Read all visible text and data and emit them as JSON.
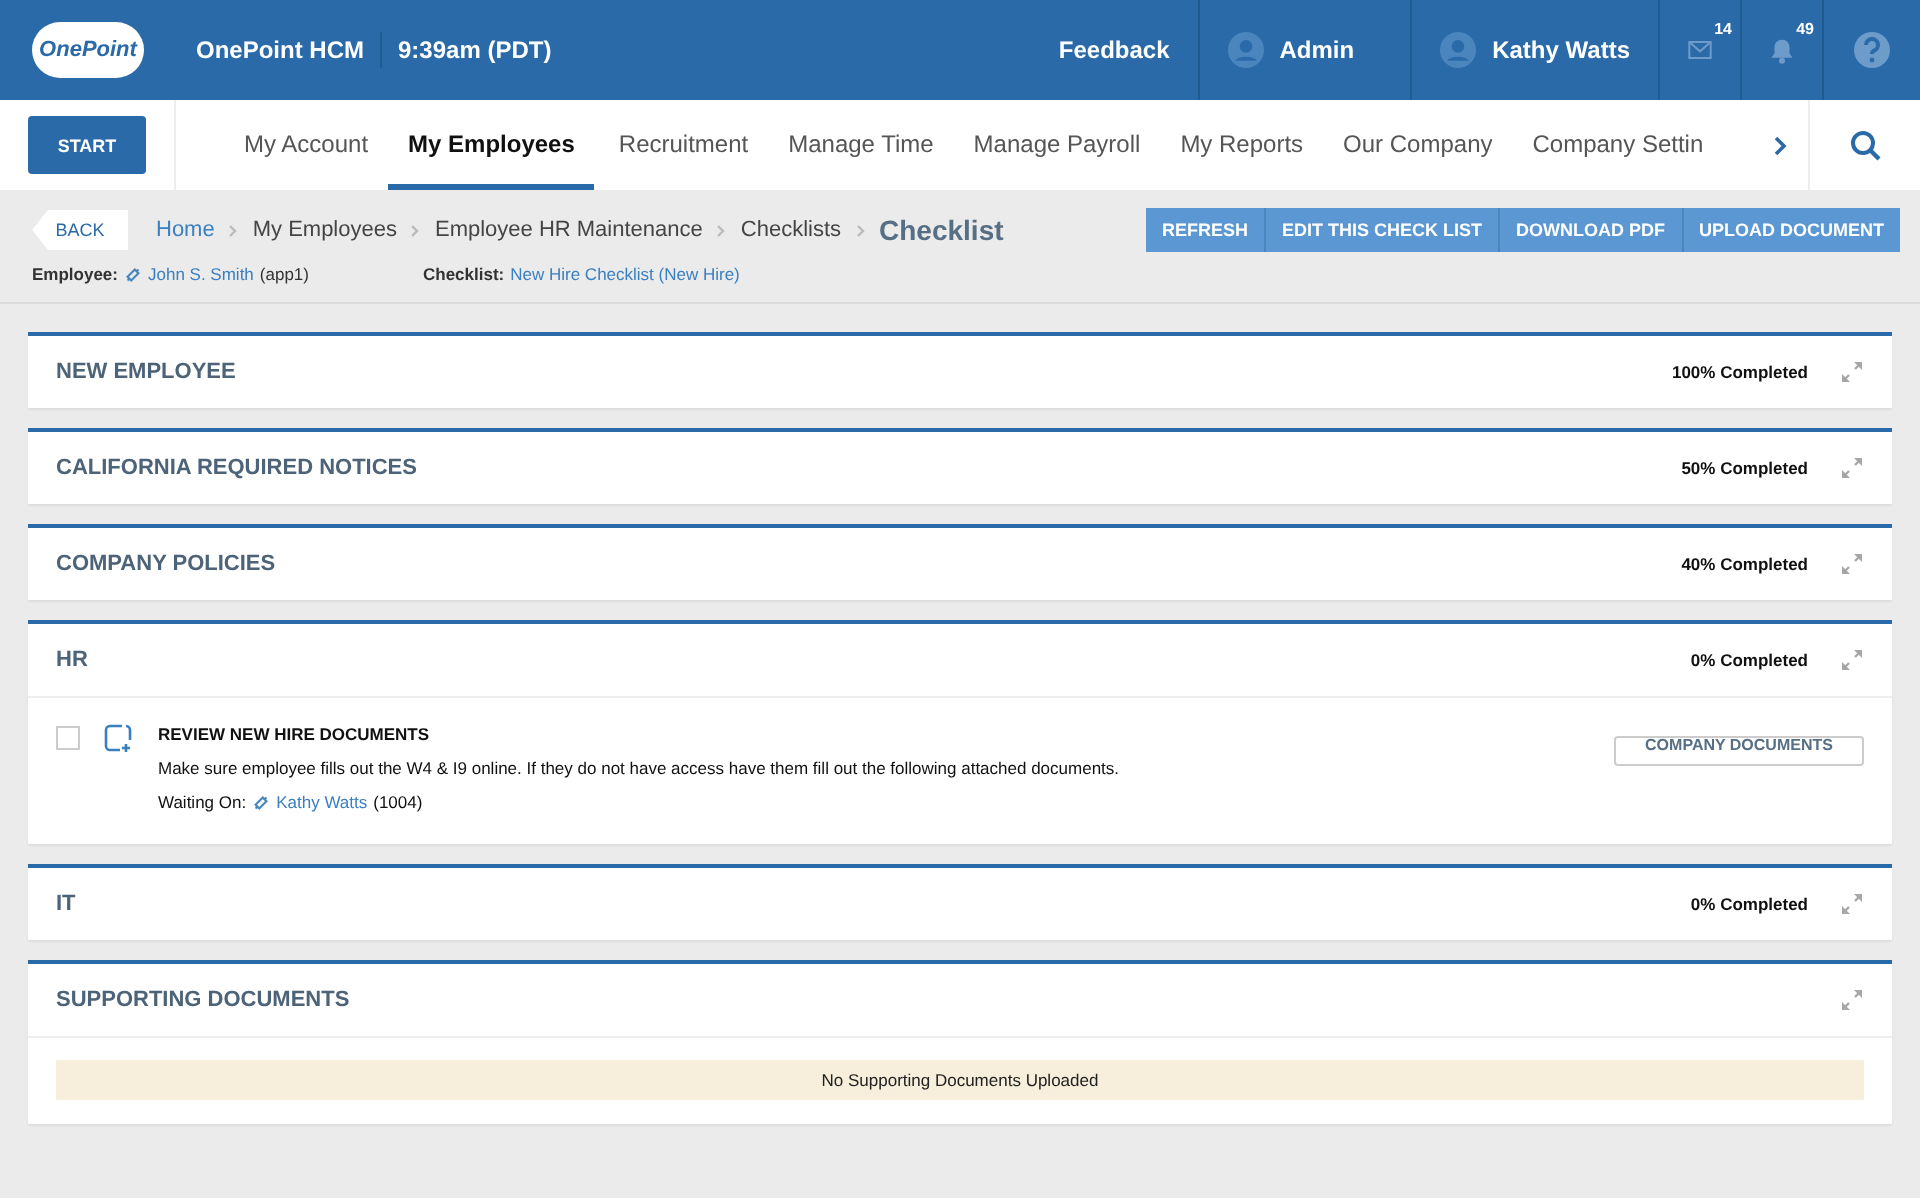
{
  "header": {
    "logo_text": "OnePoint",
    "app_name": "OnePoint HCM",
    "time": "9:39am (PDT)",
    "feedback": "Feedback",
    "role": "Admin",
    "user": "Kathy Watts",
    "mail_count": "14",
    "alert_count": "49"
  },
  "nav": {
    "start": "START",
    "items": [
      {
        "label": "My Account",
        "selected": false
      },
      {
        "label": "My Employees",
        "selected": true
      },
      {
        "label": "Recruitment",
        "selected": false
      },
      {
        "label": "Manage Time",
        "selected": false
      },
      {
        "label": "Manage Payroll",
        "selected": false
      },
      {
        "label": "My Reports",
        "selected": false
      },
      {
        "label": "Our Company",
        "selected": false
      },
      {
        "label": "Company Settin",
        "selected": false
      }
    ]
  },
  "back": "BACK",
  "breadcrumbs": [
    "Home",
    "My Employees",
    "Employee HR Maintenance",
    "Checklists"
  ],
  "page_title": "Checklist",
  "actions": [
    "REFRESH",
    "EDIT THIS CHECK LIST",
    "DOWNLOAD PDF",
    "UPLOAD DOCUMENT"
  ],
  "meta": {
    "employee_label": "Employee:",
    "employee": "John S. Smith",
    "employee_id": "(app1)",
    "checklist_label": "Checklist:",
    "checklist": "New Hire Checklist (New Hire)"
  },
  "sections": [
    {
      "title": "NEW EMPLOYEE",
      "status": "100% Completed"
    },
    {
      "title": "CALIFORNIA REQUIRED NOTICES",
      "status": "50% Completed"
    },
    {
      "title": "COMPANY POLICIES",
      "status": "40% Completed"
    },
    {
      "title": "HR",
      "status": "0% Completed",
      "tasks": [
        {
          "title": "REVIEW NEW HIRE DOCUMENTS",
          "checked": false,
          "description": "Make sure employee fills out the W4 & I9 online.  If they do not have access have them fill out the following attached documents.",
          "waiting_label": "Waiting On:",
          "waiting_on": "Kathy Watts",
          "waiting_id": "(1004)",
          "documents": "COMPANY DOCUMENTS"
        }
      ]
    },
    {
      "title": "IT",
      "status": "0% Completed"
    }
  ],
  "supporting": {
    "title": "SUPPORTING DOCUMENTS",
    "message": "No Supporting Documents Uploaded"
  }
}
